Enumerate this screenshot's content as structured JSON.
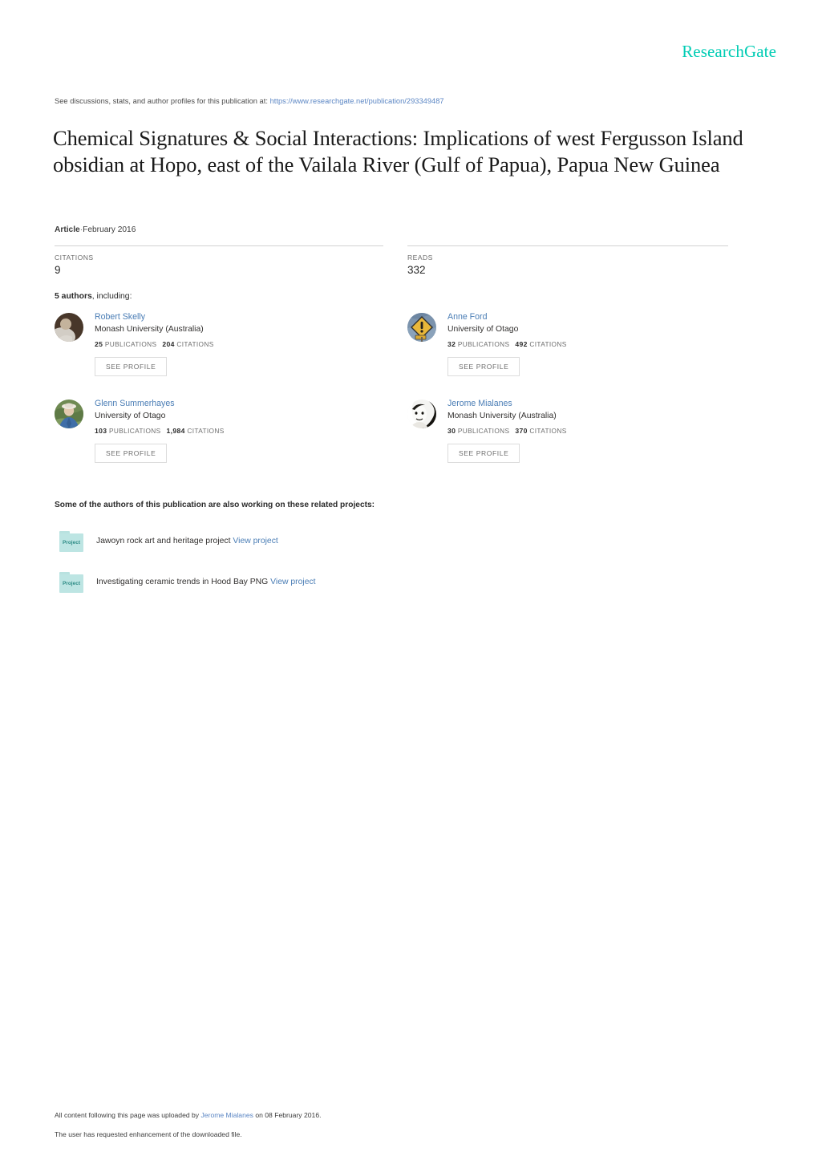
{
  "brand": {
    "name": "ResearchGate",
    "color": "#00ccb4"
  },
  "discussion": {
    "prefix": "See discussions, stats, and author profiles for this publication at:",
    "url": "https://www.researchgate.net/publication/293349487"
  },
  "publication": {
    "title": "Chemical Signatures & Social Interactions: Implications of west Fergusson Island obsidian at Hopo, east of the Vailala River (Gulf of Papua), Papua New Guinea",
    "type": "Article",
    "separator": "·",
    "date": "February 2016"
  },
  "stats": {
    "citations": {
      "label": "CITATIONS",
      "value": "9"
    },
    "reads": {
      "label": "READS",
      "value": "332"
    }
  },
  "authors_section": {
    "count_text": "5 authors",
    "suffix": ", including:",
    "see_profile_label": "SEE PROFILE",
    "publications_label": "PUBLICATIONS",
    "citations_label": "CITATIONS",
    "authors": [
      {
        "name": "Robert Skelly",
        "institution": "Monash University (Australia)",
        "publications": "25",
        "citations": "204",
        "avatar": "portrait-white-shirt-dark-background-avatar"
      },
      {
        "name": "Anne Ford",
        "institution": "University of Otago",
        "publications": "32",
        "citations": "492",
        "avatar": "warning-sign-icon-avatar"
      },
      {
        "name": "Glenn Summerhayes",
        "institution": "University of Otago",
        "publications": "103",
        "citations": "1,984",
        "avatar": "portrait-blue-shirt-outdoor-avatar"
      },
      {
        "name": "Jerome Mialanes",
        "institution": "Monash University (Australia)",
        "publications": "30",
        "citations": "370",
        "avatar": "portrait-high-contrast-bw-avatar"
      }
    ]
  },
  "projects_section": {
    "heading": "Some of the authors of this publication are also working on these related projects:",
    "icon_label": "Project",
    "view_label": "View project",
    "projects": [
      {
        "title": "Jawoyn rock art and heritage project"
      },
      {
        "title": "Investigating ceramic trends in Hood Bay PNG"
      }
    ]
  },
  "footer": {
    "upload_prefix": "All content following this page was uploaded by",
    "uploader": "Jerome Mialanes",
    "upload_suffix": "on 08 February 2016.",
    "enhancement_note": "The user has requested enhancement of the downloaded file."
  }
}
